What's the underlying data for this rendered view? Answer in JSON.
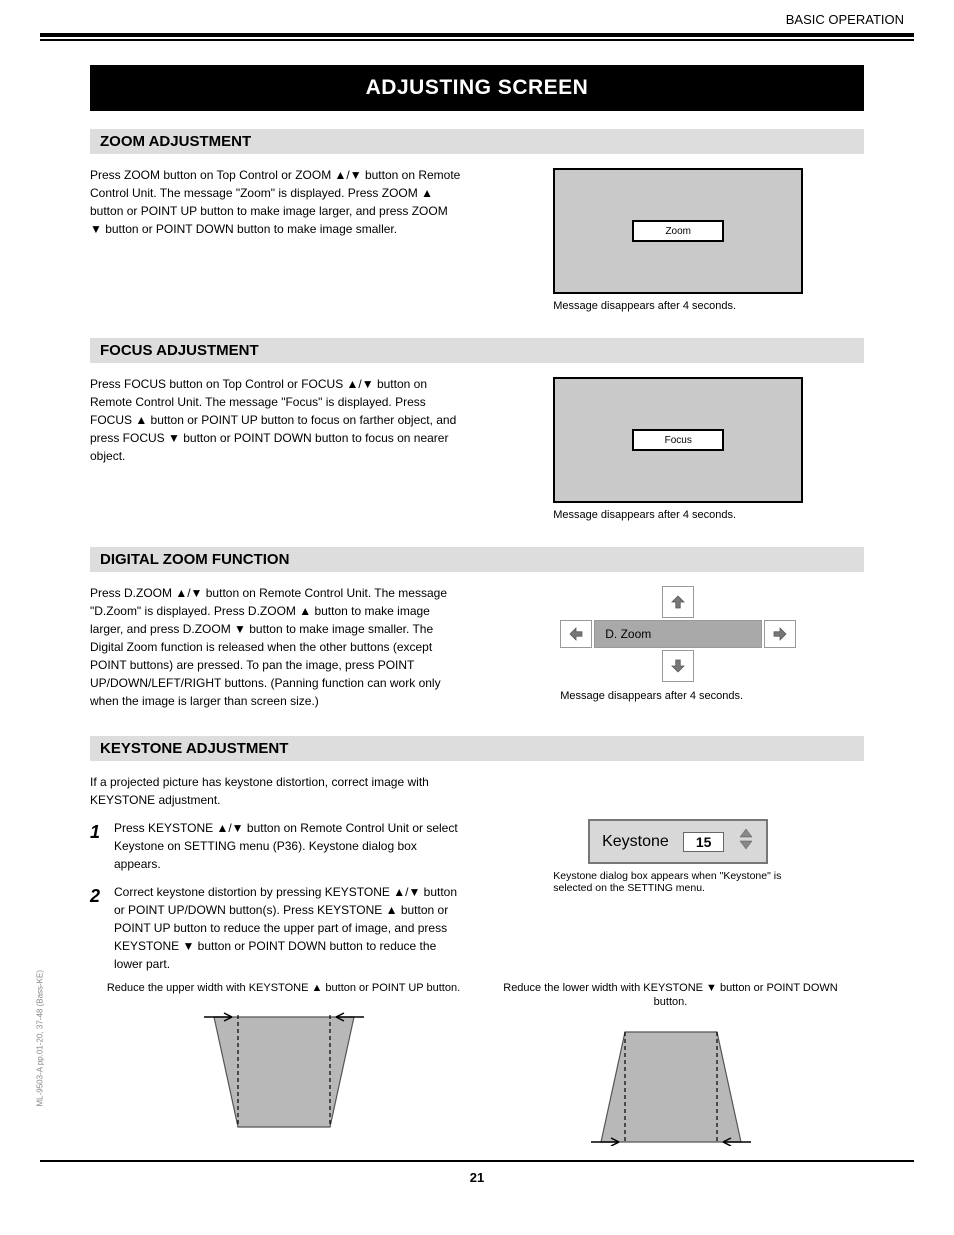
{
  "header": {
    "right": "BASIC OPERATION"
  },
  "title": "ADJUSTING SCREEN",
  "sections": {
    "zoom": {
      "title": "ZOOM ADJUSTMENT",
      "body": "Press ZOOM button on Top Control or ZOOM ▲/▼ button on Remote Control Unit. The message \"Zoom\" is displayed. Press ZOOM ▲ button or POINT UP button to make image larger, and press ZOOM ▼ button or POINT DOWN button to make image smaller.",
      "msg": "Zoom",
      "caption": "Message disappears after 4 seconds."
    },
    "focus": {
      "title": "FOCUS ADJUSTMENT",
      "body": "Press FOCUS button on Top Control or FOCUS ▲/▼ button on Remote Control Unit. The message \"Focus\" is displayed. Press FOCUS ▲ button or POINT UP button to focus on farther object, and press FOCUS ▼ button or POINT DOWN button to focus on nearer object.",
      "msg": "Focus",
      "caption": "Message disappears after 4 seconds."
    },
    "dzoom": {
      "title": "DIGITAL ZOOM FUNCTION",
      "body": "Press D.ZOOM ▲/▼ button on Remote Control Unit. The message \"D.Zoom\" is displayed. Press D.ZOOM ▲ button to make image larger, and press D.ZOOM ▼ button to make image smaller. The Digital Zoom function is released when the other buttons (except POINT buttons) are pressed. To pan the image, press POINT UP/DOWN/LEFT/RIGHT buttons. (Panning function can work only when the image is larger than screen size.)",
      "bar": "D. Zoom",
      "caption": "Message disappears after 4 seconds."
    },
    "keystone": {
      "title": "KEYSTONE ADJUSTMENT",
      "body1": "If a projected picture has keystone distortion, correct image with KEYSTONE adjustment.",
      "step1": "Press KEYSTONE ▲/▼ button on Remote Control Unit or select Keystone on SETTING menu (P36). Keystone dialog box appears.",
      "step1num": "1",
      "step2": "Correct keystone distortion by pressing KEYSTONE ▲/▼ button or POINT UP/DOWN button(s). Press KEYSTONE ▲ button or POINT UP button to reduce the upper part of image, and press KEYSTONE ▼ button or POINT DOWN button to reduce the lower part.",
      "step2num": "2",
      "ks_label": "Keystone",
      "ks_value": "15",
      "ks_caption": "Keystone dialog box appears when \"Keystone\" is selected on the SETTING menu.",
      "trap_upper": "Reduce the upper width with KEYSTONE ▲ button or POINT UP button.",
      "trap_lower": "Reduce the lower width with KEYSTONE ▼ button or POINT DOWN button."
    }
  },
  "footer": {
    "page": "21",
    "side": "ML-9503-A pp.01-20, 37-48 (Bass-KE)"
  }
}
